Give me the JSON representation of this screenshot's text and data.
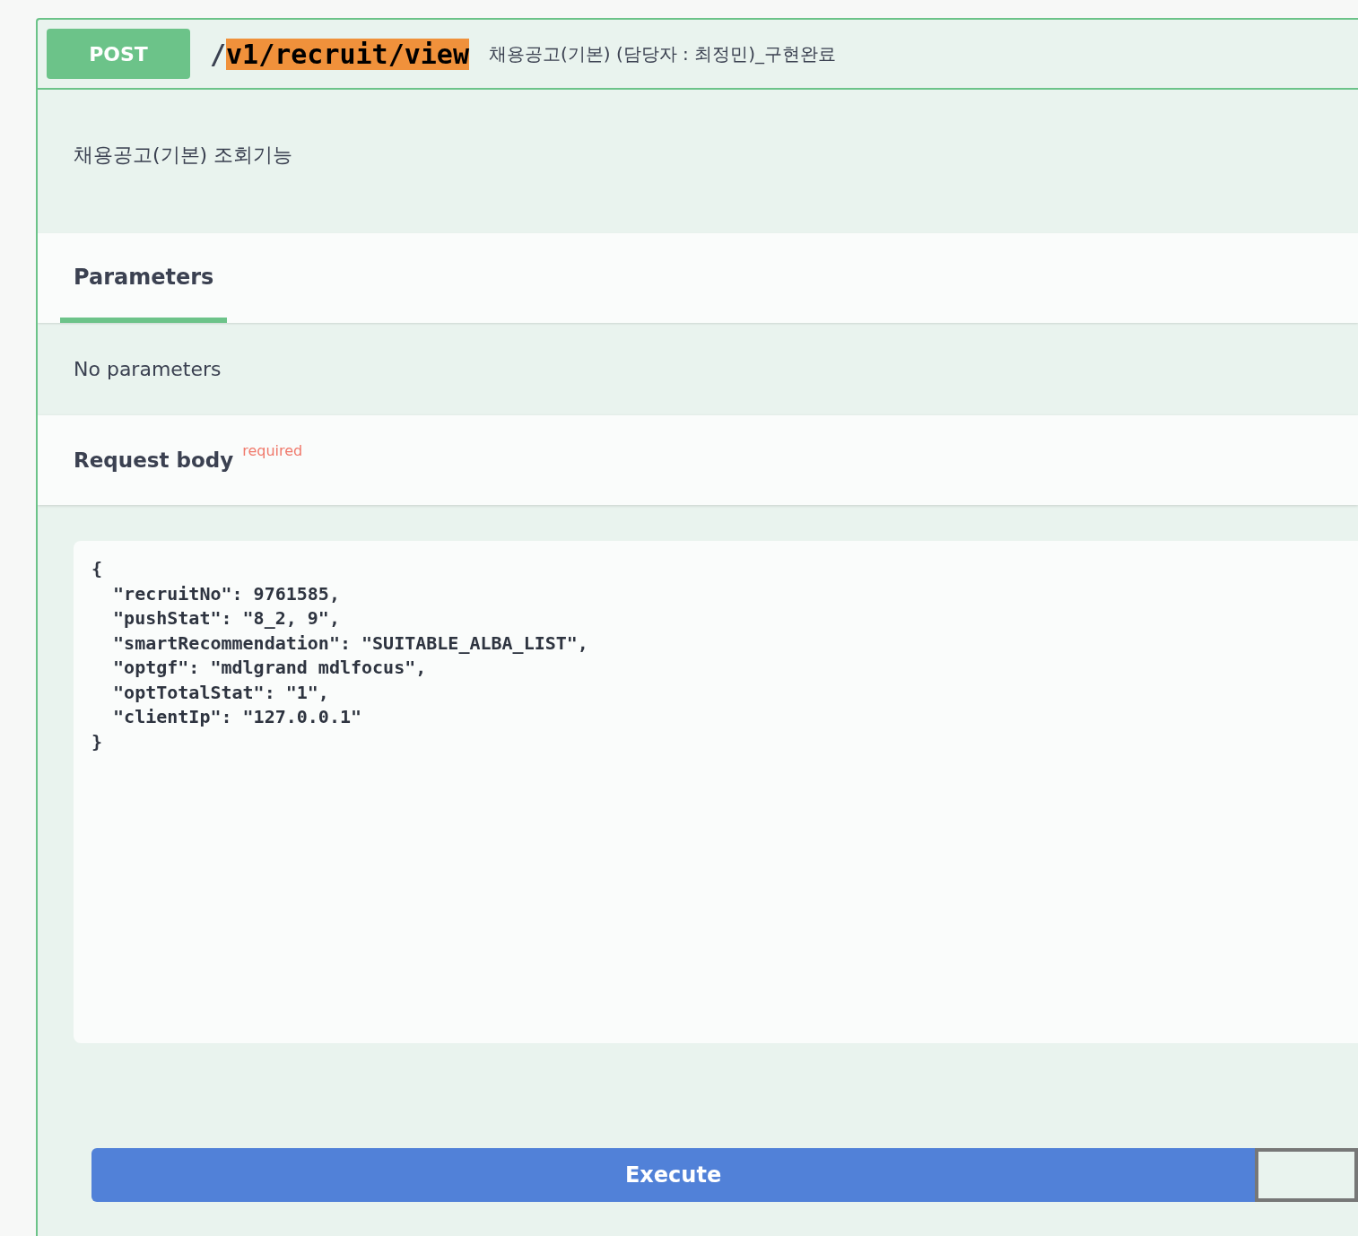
{
  "operation": {
    "method": "POST",
    "path": [
      {
        "text": "/",
        "highlighted": false
      },
      {
        "text": "v1/recruit/view",
        "highlighted": true
      }
    ],
    "summary": "채용공고(기본) (담당자 : 최정민)_구현완료"
  },
  "description": "채용공고(기본) 조회기능",
  "tabs": [
    {
      "label": "Parameters",
      "selected": true
    }
  ],
  "parameters_message": "No parameters",
  "request_body": {
    "title": "Request body",
    "required_label": "required",
    "value": "{\n  \"recruitNo\": 9761585,\n  \"pushStat\": \"8_2, 9\",\n  \"smartRecommendation\": \"SUITABLE_ALBA_LIST\",\n  \"optgf\": \"mdlgrand mdlfocus\",\n  \"optTotalStat\": \"1\",\n  \"clientIp\": \"127.0.0.1\"\n}"
  },
  "buttons": [
    {
      "kind": "primary",
      "label": "Execute"
    },
    {
      "kind": "secondary"
    }
  ]
}
